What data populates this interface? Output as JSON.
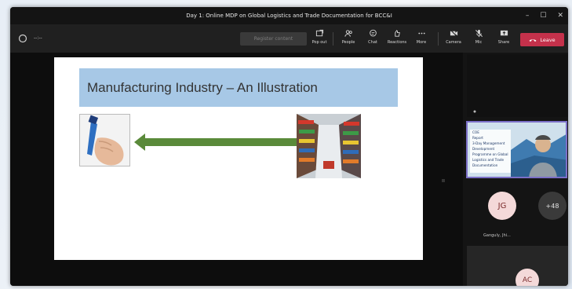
{
  "window": {
    "title": "Day 1: Online MDP on Global Logistics and Trade Documentation for BCC&I",
    "controls": [
      "–",
      "☐",
      "✕"
    ]
  },
  "toolbar": {
    "timer": "--:--",
    "record_label": "Register content",
    "items": [
      {
        "label": "Pop out",
        "icon": "pop-out-icon"
      },
      {
        "label": "People",
        "icon": "people-icon"
      },
      {
        "label": "Chat",
        "icon": "chat-icon"
      },
      {
        "label": "Reactions",
        "icon": "reactions-icon"
      },
      {
        "label": "More",
        "icon": "more-icon"
      },
      {
        "label": "Camera",
        "icon": "camera-icon"
      },
      {
        "label": "Mic",
        "icon": "mic-icon"
      },
      {
        "label": "Share",
        "icon": "share-icon"
      }
    ],
    "leave_label": "Leave"
  },
  "slide": {
    "title": "Manufacturing Industry – An Illustration"
  },
  "participants": {
    "presenter_tile_lines": [
      "COE",
      "Report",
      "3-Day Management",
      "Development",
      "Programme on Global",
      "Logistics and Trade",
      "Documentation"
    ],
    "jg_initials": "JG",
    "jg_name": "Ganguly, Jhi...",
    "more_count": "+48",
    "ac_initials": "AC"
  },
  "colors": {
    "leave": "#c4314b",
    "slide_title_bg": "#a7c8e6",
    "arrow": "#5a8a3a",
    "active_speaker_border": "#7b6fc7"
  }
}
